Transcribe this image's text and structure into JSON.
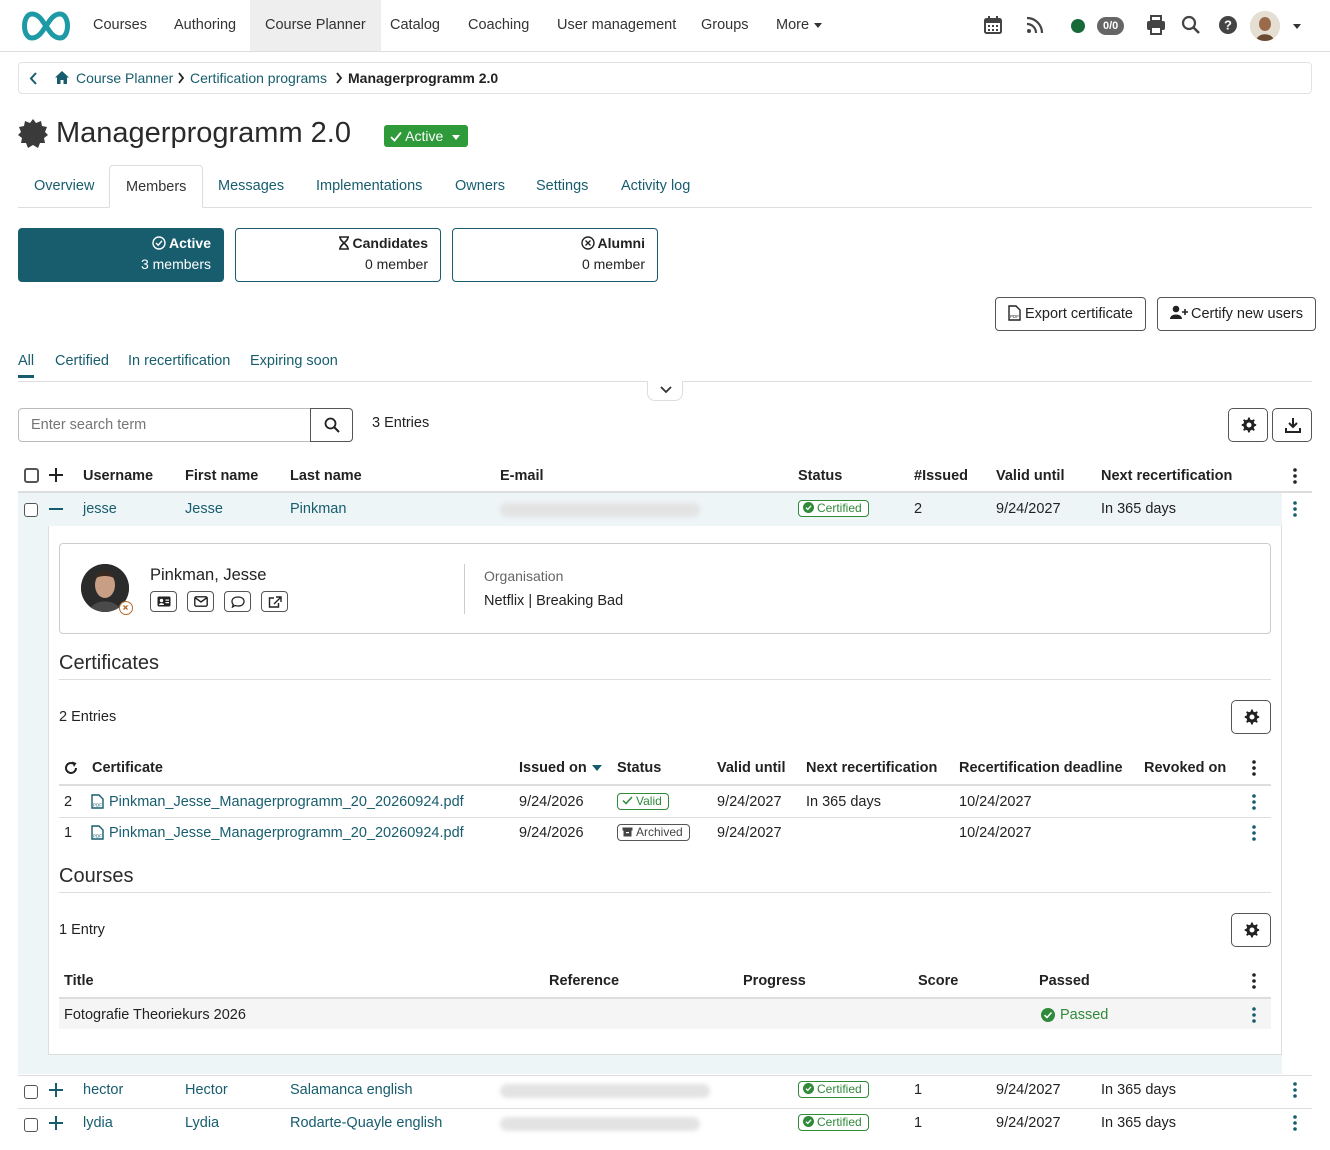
{
  "nav": {
    "items": [
      "Courses",
      "Authoring",
      "Course Planner",
      "Catalog",
      "Coaching",
      "User management",
      "Groups",
      "More"
    ],
    "active": "Course Planner",
    "counter": "0/0"
  },
  "breadcrumb": {
    "items": [
      "Course Planner",
      "Certification programs"
    ],
    "current": "Managerprogramm 2.0"
  },
  "page": {
    "title": "Managerprogramm 2.0",
    "status": "Active"
  },
  "tabs": [
    "Overview",
    "Members",
    "Messages",
    "Implementations",
    "Owners",
    "Settings",
    "Activity log"
  ],
  "cards": [
    {
      "title": "Active",
      "value": "3 members"
    },
    {
      "title": "Candidates",
      "value": "0 member"
    },
    {
      "title": "Alumni",
      "value": "0 member"
    }
  ],
  "actions": {
    "export": "Export certificate",
    "certify": "Certify new users"
  },
  "subtabs": [
    "All",
    "Certified",
    "In recertification",
    "Expiring soon"
  ],
  "search": {
    "placeholder": "Enter search term",
    "entries": "3 Entries"
  },
  "columns": [
    "Username",
    "First name",
    "Last name",
    "E-mail",
    "Status",
    "#Issued",
    "Valid until",
    "Next recertification"
  ],
  "rows": [
    {
      "username": "jesse",
      "first": "Jesse",
      "last": "Pinkman",
      "status": "Certified",
      "issued": "2",
      "valid": "9/24/2027",
      "next": "In 365 days"
    },
    {
      "username": "hector",
      "first": "Hector",
      "last": "Salamanca english",
      "status": "Certified",
      "issued": "1",
      "valid": "9/24/2027",
      "next": "In 365 days"
    },
    {
      "username": "lydia",
      "first": "Lydia",
      "last": "Rodarte-Quayle english",
      "status": "Certified",
      "issued": "1",
      "valid": "9/24/2027",
      "next": "In 365 days"
    }
  ],
  "detail": {
    "name": "Pinkman, Jesse",
    "org_label": "Organisation",
    "org_value": "Netflix | Breaking Bad",
    "certificates": {
      "title": "Certificates",
      "entries": "2 Entries",
      "columns": [
        "Certificate",
        "Issued on",
        "Status",
        "Valid until",
        "Next recertification",
        "Recertification deadline",
        "Revoked on"
      ],
      "rows": [
        {
          "no": "2",
          "file": "Pinkman_Jesse_Managerprogramm_20_20260924.pdf",
          "issued": "9/24/2026",
          "status": "Valid",
          "valid": "9/24/2027",
          "next": "In 365 days",
          "deadline": "10/24/2027"
        },
        {
          "no": "1",
          "file": "Pinkman_Jesse_Managerprogramm_20_20260924.pdf",
          "issued": "9/24/2026",
          "status": "Archived",
          "valid": "9/24/2027",
          "next": "",
          "deadline": "10/24/2027"
        }
      ]
    },
    "courses": {
      "title": "Courses",
      "entries": "1 Entry",
      "columns": [
        "Title",
        "Reference",
        "Progress",
        "Score",
        "Passed"
      ],
      "rows": [
        {
          "title": "Fotografie Theoriekurs 2026",
          "passed": "Passed"
        }
      ]
    }
  },
  "colors": {
    "accent": "#175d6e",
    "success": "#2f9a3a"
  }
}
